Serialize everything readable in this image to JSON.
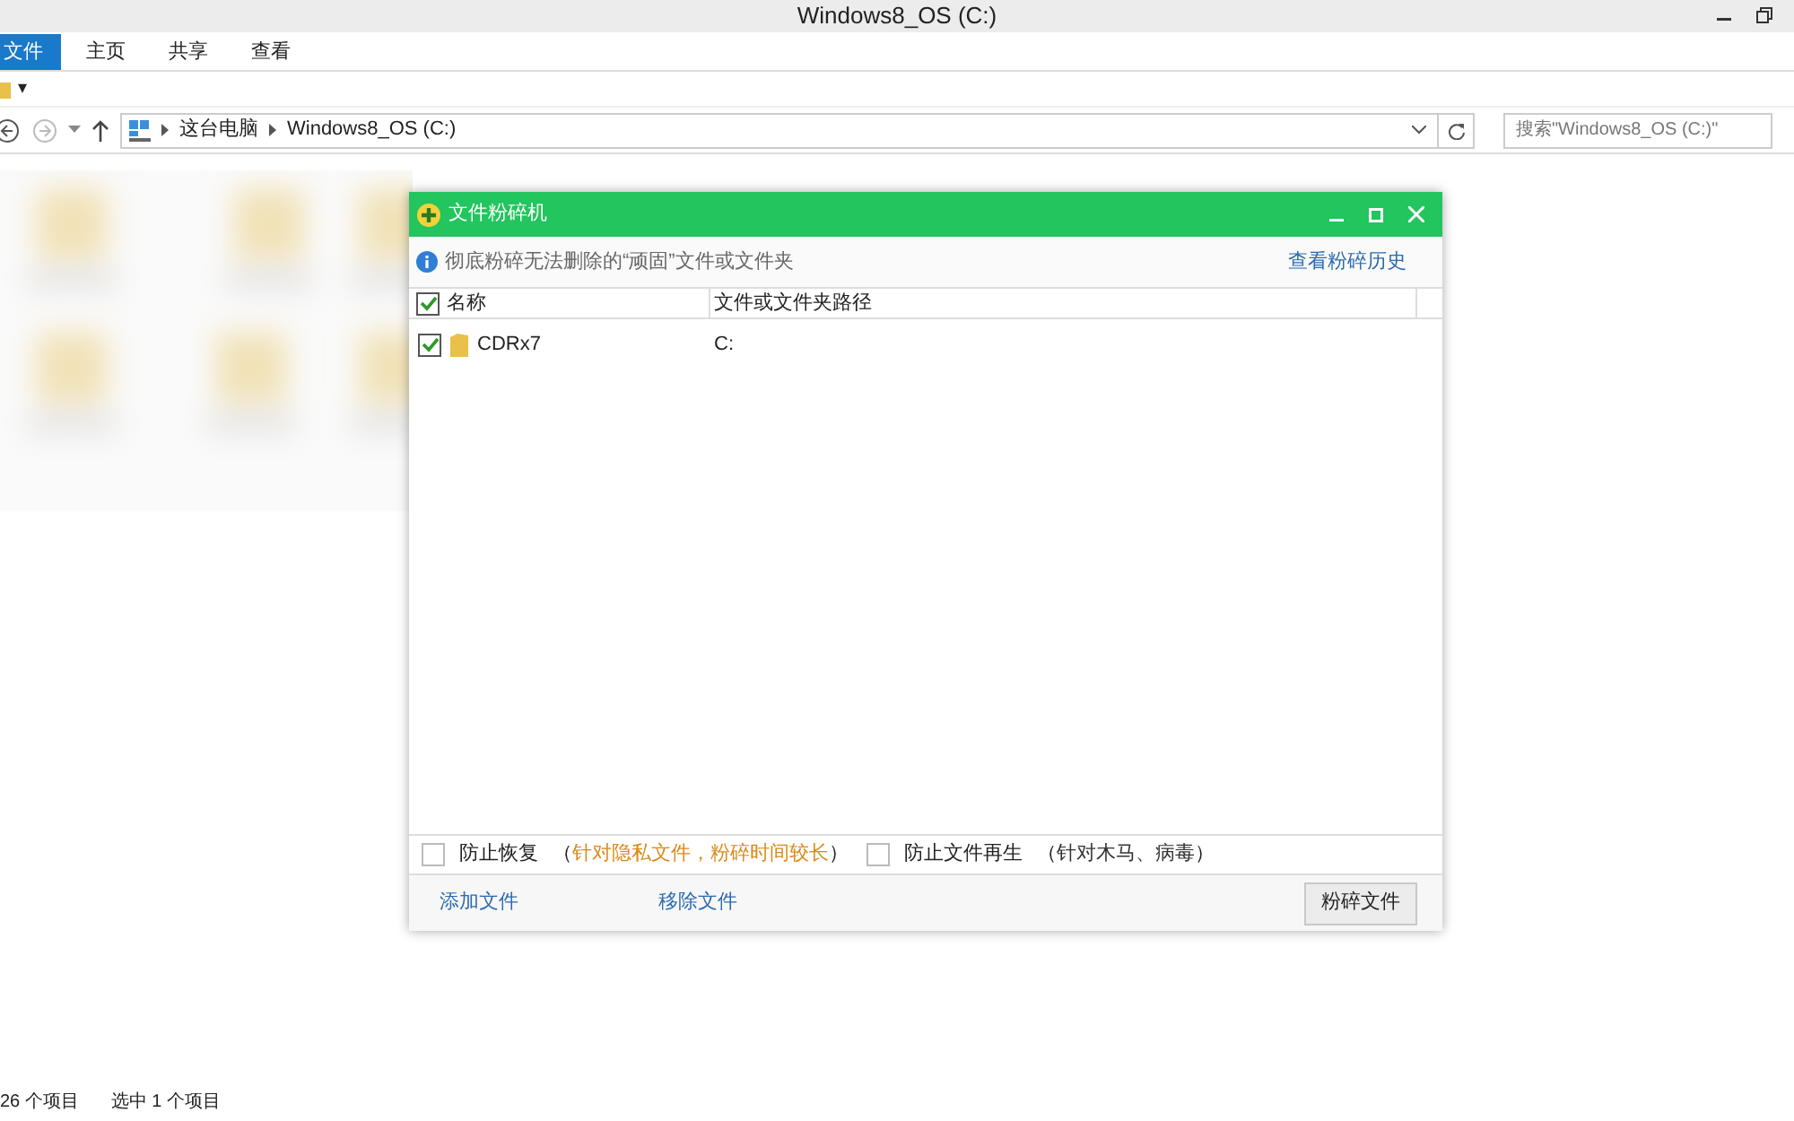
{
  "window": {
    "title": "Windows8_OS (C:)"
  },
  "ribbon_tabs": [
    {
      "label": "文件",
      "selected": true
    },
    {
      "label": "主页",
      "selected": false
    },
    {
      "label": "共享",
      "selected": false
    },
    {
      "label": "查看",
      "selected": false
    }
  ],
  "quick_access": {
    "dropdown": "▾"
  },
  "address_bar": {
    "path": [
      "这台电脑",
      "Windows8_OS (C:)"
    ]
  },
  "search": {
    "placeholder": "搜索\"Windows8_OS (C:)\""
  },
  "dialog": {
    "title": "文件粉碎机",
    "info": "彻底粉碎无法删除的“顽固”文件或文件夹",
    "history_link": "查看粉碎历史",
    "columns": [
      "名称",
      "文件或文件夹路径"
    ],
    "all_checked": true,
    "rows": [
      {
        "name": "CDRx7",
        "path": "C:",
        "checked": true
      }
    ],
    "options": [
      {
        "label": "防止恢复",
        "open": "（",
        "note": "针对隐私文件，粉碎时间较长",
        "close": "）",
        "color": "#d98a1a",
        "checked": false
      },
      {
        "label": "防止文件再生",
        "open": "（",
        "note": "针对木马、病毒",
        "close": "）",
        "color": "#333333",
        "checked": false
      }
    ],
    "links": [
      "添加文件",
      "移除文件"
    ],
    "button": "粉碎文件"
  },
  "status_bar": {
    "count": "26 个项目",
    "selection": "选中 1 个项目"
  }
}
